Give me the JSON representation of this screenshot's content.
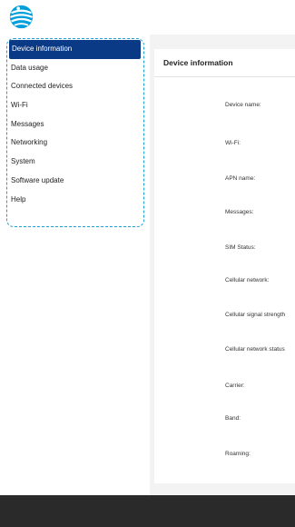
{
  "sidebar": {
    "items": [
      {
        "label": "Device information",
        "active": true
      },
      {
        "label": "Data usage"
      },
      {
        "label": "Connected devices"
      },
      {
        "label": "Wi-Fi"
      },
      {
        "label": "Messages"
      },
      {
        "label": "Networking"
      },
      {
        "label": "System"
      },
      {
        "label": "Software update"
      },
      {
        "label": "Help"
      }
    ]
  },
  "main": {
    "title": "Device information",
    "fields": [
      "Device name:",
      "Wi-Fi:",
      "APN name:",
      "Messages:",
      "SIM Status:",
      "Cellular network:",
      "Cellular signal strength",
      "Cellular network status",
      "Carrier:",
      "Band:",
      "Roaming:"
    ]
  },
  "colors": {
    "accent": "#0a3a86",
    "highlight_border": "#1f9ed1",
    "logo": "#009fdb",
    "footer": "#2a2a2a"
  },
  "icons": {
    "logo": "att-globe-logo"
  }
}
